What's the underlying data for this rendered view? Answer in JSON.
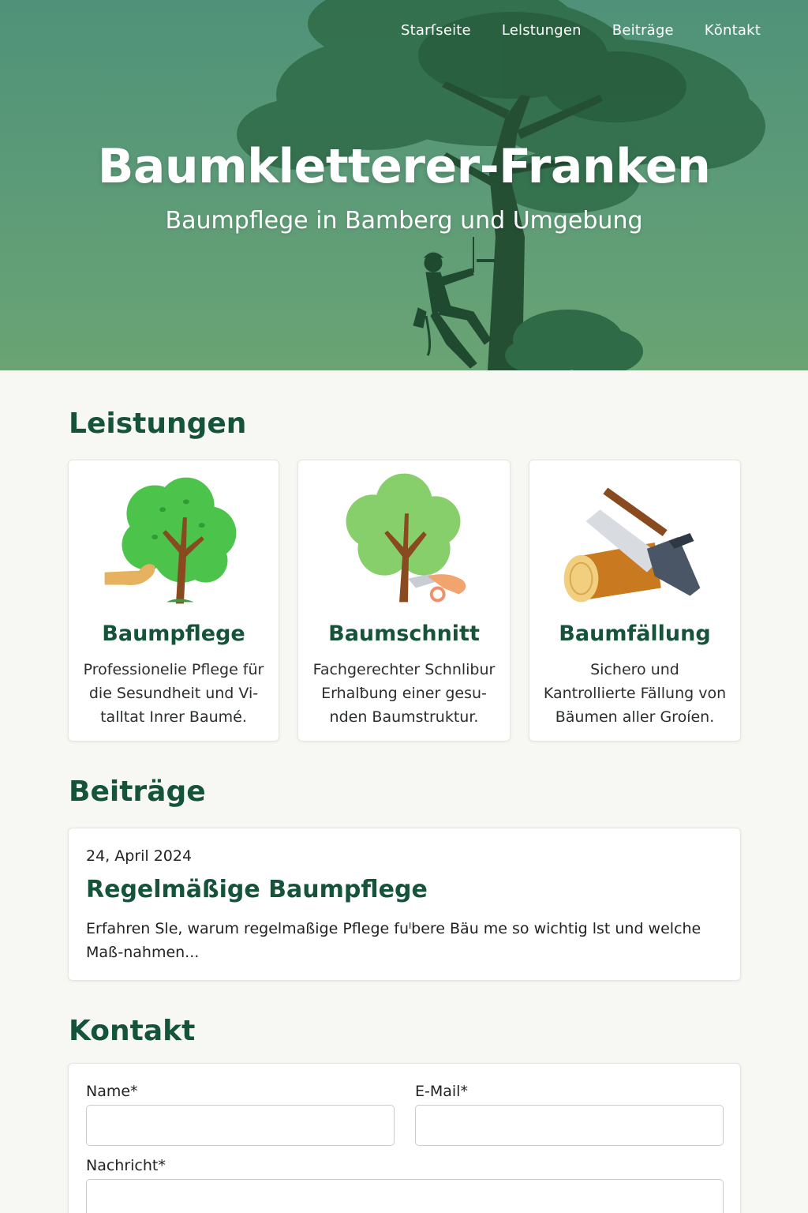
{
  "nav": {
    "items": [
      {
        "label": "Starſseite"
      },
      {
        "label": "Lelstungen"
      },
      {
        "label": "Beiträge"
      },
      {
        "label": "Kŏntakt"
      }
    ]
  },
  "hero": {
    "title": "Baumkletterer-Franken",
    "subtitle": "Baumpflege in Bamberg und Umgebung"
  },
  "services": {
    "heading": "Leistungen",
    "items": [
      {
        "title": "Baumpflege",
        "text": "Professionelie Pflege für die Sesundheit und Vi-talltat Inrer Baumé.",
        "icon": "tree-hand-icon"
      },
      {
        "title": "Baumschnitt",
        "text": "Fachgerechter Schnlibur Erhalƀung einer gesu-nden Baumstruktur.",
        "icon": "tree-pruning-shears-icon"
      },
      {
        "title": "Baumfällung",
        "text": "Sichero und Kantrollierte Fällung von Bäumen aller Groíen.",
        "icon": "log-chainsaw-icon"
      }
    ]
  },
  "posts": {
    "heading": "Beiträge",
    "items": [
      {
        "date": "24, April 2024",
        "title": "Regelmäßige Baumpflege",
        "excerpt": "Erfahren Sle, warum regelmaßige Pflege fuˡbere Bäu me so wichtig lst und welche Maß-nahmen..."
      }
    ]
  },
  "contact": {
    "heading": "Kontakt",
    "name_label": "Name*",
    "name_value": "",
    "email_label": "E-Mail*",
    "email_value": "",
    "message_label": "Nachricht*",
    "message_value": ""
  },
  "colors": {
    "brand_green": "#15543a",
    "hero_top": "#4f9279",
    "hero_bottom": "#6aa474",
    "page_bg": "#f7f7f3"
  }
}
